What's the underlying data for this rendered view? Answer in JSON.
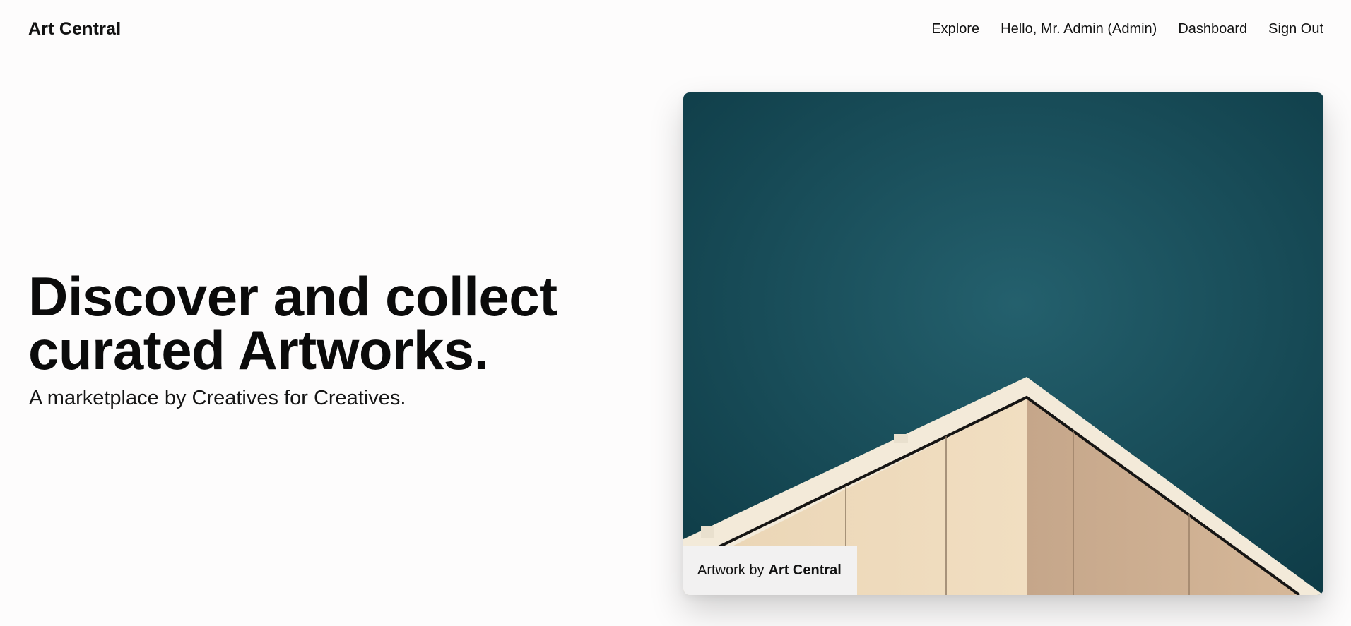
{
  "header": {
    "brand": "Art Central",
    "nav": {
      "explore": "Explore",
      "greeting": "Hello, Mr. Admin (Admin)",
      "dashboard": "Dashboard",
      "sign_out": "Sign Out"
    }
  },
  "hero": {
    "title_line1": "Discover and collect",
    "title_line2": "curated Artworks.",
    "subtitle": "A marketplace by Creatives for Creatives."
  },
  "featured_artwork": {
    "caption_prefix": "Artwork by",
    "artist": "Art Central",
    "colors": {
      "sky_top": "#0e3b46",
      "sky_bottom": "#24606d",
      "wall_light": "#e8cfae",
      "wall_shadow": "#c9a789",
      "trim": "#f3ead9"
    }
  }
}
